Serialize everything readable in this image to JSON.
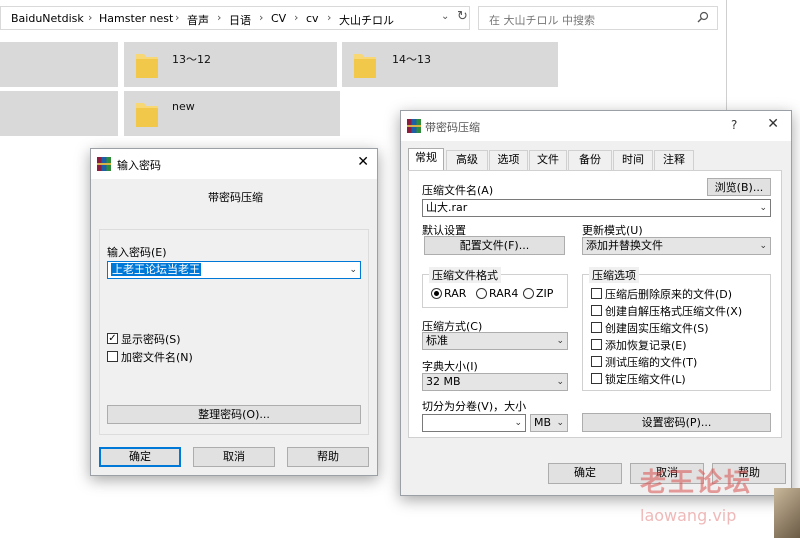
{
  "explorer": {
    "breadcrumb": [
      "BaiduNetdisk",
      "Hamster nest",
      "音声",
      "日语",
      "CV",
      "cv",
      "大山チロル"
    ],
    "search_placeholder": "在 大山チロル 中搜索",
    "folders": [
      "13～12",
      "14～13",
      "new"
    ]
  },
  "pwd_dialog": {
    "title": "输入密码",
    "subtitle": "带密码压缩",
    "enter_label": "输入密码(E)",
    "password_value": "上老王论坛当老王",
    "show_password": "显示密码(S)",
    "encrypt_names": "加密文件名(N)",
    "show_checked": true,
    "encrypt_checked": false,
    "organize_button": "整理密码(O)...",
    "ok": "确定",
    "cancel": "取消",
    "help": "帮助"
  },
  "rar_dialog": {
    "title": "带密码压缩",
    "help_glyph": "?",
    "tabs": [
      "常规",
      "高级",
      "选项",
      "文件",
      "备份",
      "时间",
      "注释"
    ],
    "archive_name_label": "压缩文件名(A)",
    "browse": "浏览(B)...",
    "archive_name": "山大.rar",
    "default_settings": "默认设置",
    "profiles_button": "配置文件(F)...",
    "update_mode_label": "更新模式(U)",
    "update_mode": "添加并替换文件",
    "format_group": "压缩文件格式",
    "formats": [
      "RAR",
      "RAR4",
      "ZIP"
    ],
    "format_selected": "RAR",
    "options_group": "压缩选项",
    "options": [
      "压缩后删除原来的文件(D)",
      "创建自解压格式压缩文件(X)",
      "创建固实压缩文件(S)",
      "添加恢复记录(E)",
      "测试压缩的文件(T)",
      "锁定压缩文件(L)"
    ],
    "method_label": "压缩方式(C)",
    "method": "标准",
    "dict_label": "字典大小(I)",
    "dict": "32 MB",
    "split_label": "切分为分卷(V)，大小",
    "split_unit": "MB",
    "set_password": "设置密码(P)...",
    "ok": "确定",
    "cancel": "取消",
    "help": "帮助"
  },
  "watermark": {
    "cn": "老王论坛",
    "url": "laowang.vip"
  },
  "colors": {
    "accent": "#0078d7",
    "folder": "#f8d775",
    "tile": "#d9d9d9"
  }
}
